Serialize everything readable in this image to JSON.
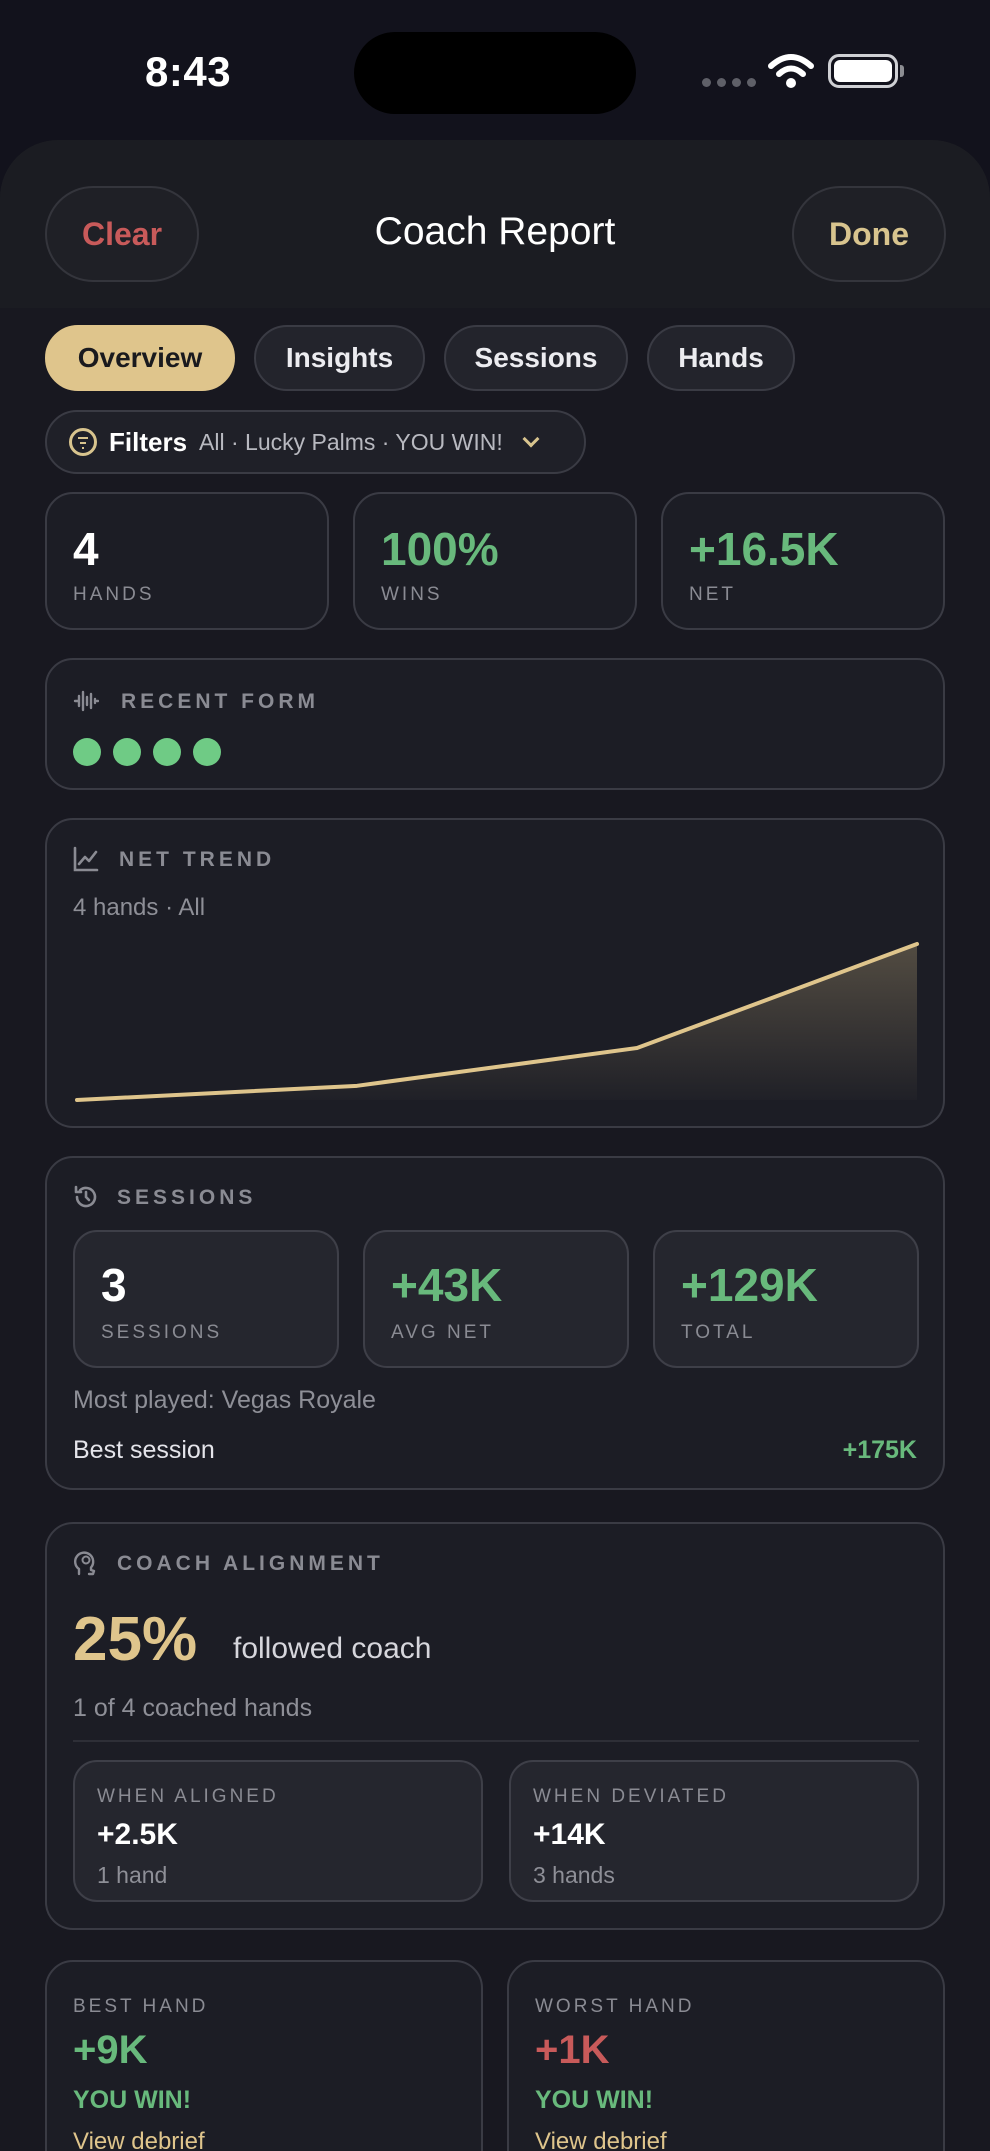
{
  "status": {
    "time": "8:43"
  },
  "header": {
    "clear_label": "Clear",
    "title": "Coach Report",
    "done_label": "Done"
  },
  "tabs": [
    {
      "label": "Overview",
      "active": true
    },
    {
      "label": "Insights",
      "active": false
    },
    {
      "label": "Sessions",
      "active": false
    },
    {
      "label": "Hands",
      "active": false
    }
  ],
  "filters": {
    "label": "Filters",
    "value": "All · Lucky Palms · YOU WIN!"
  },
  "summary": [
    {
      "value": "4",
      "label": "HANDS"
    },
    {
      "value": "100%",
      "label": "WINS"
    },
    {
      "value": "+16.5K",
      "label": "NET"
    }
  ],
  "recent_form": {
    "title": "RECENT FORM",
    "results": [
      "win",
      "win",
      "win",
      "win"
    ]
  },
  "net_trend": {
    "title": "NET TREND",
    "subtitle": "4 hands · All"
  },
  "chart_data": {
    "type": "area",
    "title": "NET TREND",
    "x": [
      0,
      1,
      2,
      3,
      4
    ],
    "values": [
      0,
      1.5,
      5.5,
      16.5
    ],
    "xlabel": "",
    "ylabel": "",
    "grid": false,
    "colors": {
      "line": "#dfc58c"
    }
  },
  "sessions": {
    "title": "SESSIONS",
    "stats": [
      {
        "value": "3",
        "label": "SESSIONS"
      },
      {
        "value": "+43K",
        "label": "AVG NET"
      },
      {
        "value": "+129K",
        "label": "TOTAL"
      }
    ],
    "most_played": "Most played: Vegas Royale",
    "best_session_label": "Best session",
    "best_session_value": "+175K"
  },
  "coach_alignment": {
    "title": "COACH ALIGNMENT",
    "percent": "25%",
    "percent_label": "followed coach",
    "detail": "1 of 4 coached hands",
    "aligned": {
      "label": "WHEN ALIGNED",
      "value": "+2.5K",
      "count": "1 hand"
    },
    "deviated": {
      "label": "WHEN DEVIATED",
      "value": "+14K",
      "count": "3 hands"
    }
  },
  "best_hand": {
    "label": "BEST HAND",
    "value": "+9K",
    "result": "YOU WIN!",
    "link": "View debrief"
  },
  "worst_hand": {
    "label": "WORST HAND",
    "value": "+1K",
    "result": "YOU WIN!",
    "link": "View debrief"
  },
  "colors": {
    "accent": "#dfc58c",
    "positive": "#68b97c",
    "negative": "#c85a5a",
    "background": "#12121c"
  }
}
